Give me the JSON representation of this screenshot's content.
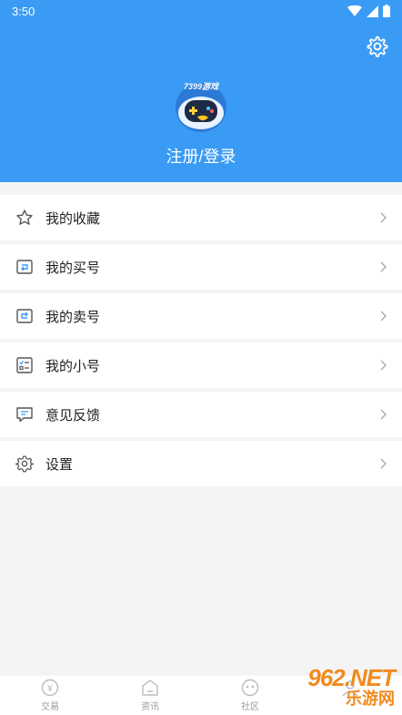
{
  "status_bar": {
    "time": "3:50"
  },
  "profile": {
    "login_label": "注册/登录",
    "avatar_text": "7399游戏"
  },
  "menu": {
    "items": [
      {
        "label": "我的收藏",
        "icon": "star-icon"
      },
      {
        "label": "我的买号",
        "icon": "buy-account-icon"
      },
      {
        "label": "我的卖号",
        "icon": "sell-account-icon"
      },
      {
        "label": "我的小号",
        "icon": "sub-account-icon"
      },
      {
        "label": "意见反馈",
        "icon": "feedback-icon"
      },
      {
        "label": "设置",
        "icon": "gear-icon"
      }
    ]
  },
  "bottom_nav": {
    "items": [
      {
        "label": "交易",
        "icon": "trade-icon"
      },
      {
        "label": "资讯",
        "icon": "news-icon"
      },
      {
        "label": "社区",
        "icon": "community-icon"
      },
      {
        "label": "",
        "icon": "mine-icon"
      }
    ]
  },
  "watermark": {
    "top": "962.NET",
    "bottom": "乐游网"
  },
  "colors": {
    "header": "#3a9bf5",
    "background": "#f4f4f5",
    "watermark": "#f28a1e"
  }
}
